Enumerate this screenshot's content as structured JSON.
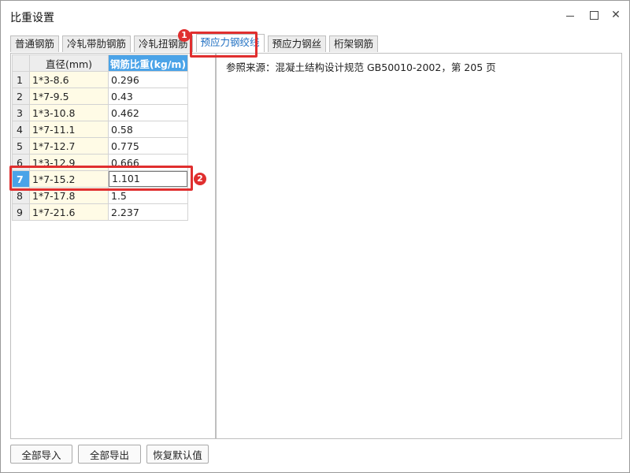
{
  "window": {
    "title": "比重设置",
    "minimize_icon": "minimize-icon",
    "maximize_icon": "maximize-icon",
    "close_glyph": "✕"
  },
  "tabs": [
    {
      "label": "普通钢筋"
    },
    {
      "label": "冷轧带肋钢筋"
    },
    {
      "label": "冷轧扭钢筋"
    },
    {
      "label": "预应力钢绞线",
      "active": true
    },
    {
      "label": "预应力钢丝"
    },
    {
      "label": "桁架钢筋"
    }
  ],
  "annotations": {
    "marker1": "1",
    "marker2": "2",
    "color": "#e02f2f"
  },
  "table": {
    "columns": [
      "直径(mm)",
      "钢筋比重(kg/m)"
    ],
    "rows": [
      {
        "num": "1",
        "diameter": "1*3-8.6",
        "weight": "0.296"
      },
      {
        "num": "2",
        "diameter": "1*7-9.5",
        "weight": "0.43"
      },
      {
        "num": "3",
        "diameter": "1*3-10.8",
        "weight": "0.462"
      },
      {
        "num": "4",
        "diameter": "1*7-11.1",
        "weight": "0.58"
      },
      {
        "num": "5",
        "diameter": "1*7-12.7",
        "weight": "0.775"
      },
      {
        "num": "6",
        "diameter": "1*3-12.9",
        "weight": "0.666"
      },
      {
        "num": "7",
        "diameter": "1*7-15.2",
        "weight": "1.101"
      },
      {
        "num": "8",
        "diameter": "1*7-17.8",
        "weight": "1.5"
      },
      {
        "num": "9",
        "diameter": "1*7-21.6",
        "weight": "2.237"
      }
    ],
    "selected_row": "7"
  },
  "reference": {
    "text": "参照来源：混凝土结构设计规范 GB50010-2002，第 205 页"
  },
  "buttons": {
    "import_all": "全部导入",
    "export_all": "全部导出",
    "restore_default": "恢复默认值"
  },
  "colors": {
    "accent": "#4aa3e8",
    "active_tab_text": "#1f6fc2",
    "diameter_cell_bg": "#fffbe6"
  }
}
